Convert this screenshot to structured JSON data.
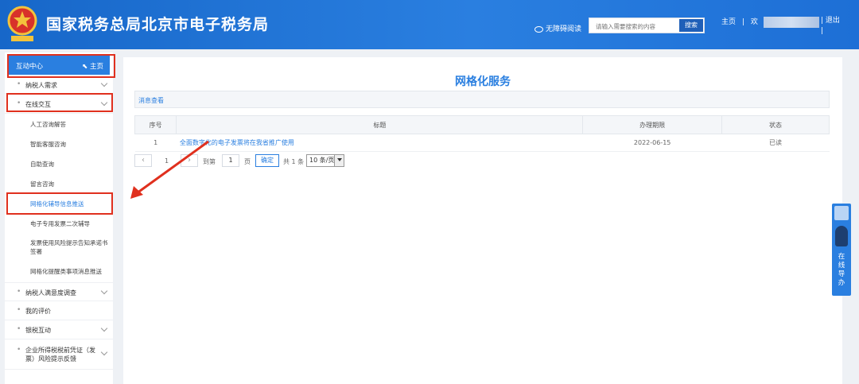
{
  "header": {
    "title": "国家税务总局北京市电子税务局",
    "accessible_label": "无障碍阅读",
    "search_placeholder": "请输入需要搜索的内容",
    "search_button": "搜索",
    "home_link": "主页",
    "welcome": "欢",
    "logout": "退出",
    "separator": "|"
  },
  "sidebar": {
    "head_title": "互动中心",
    "head_home": "主页",
    "items": [
      {
        "label": "纳税人需求"
      },
      {
        "label": "在线交互"
      },
      {
        "label": "纳税人满意度调查"
      },
      {
        "label": "我的评价"
      },
      {
        "label": "银税互动"
      },
      {
        "label": "企业所得税税前凭证（发票）风险提示反馈"
      }
    ],
    "subitems": [
      {
        "label": "人工咨询解答"
      },
      {
        "label": "智能客服咨询"
      },
      {
        "label": "自助查询"
      },
      {
        "label": "留言咨询"
      },
      {
        "label": "网格化辅导信息推送"
      },
      {
        "label": "电子专用发票二次辅导"
      },
      {
        "label": "发票使用风险提示告知承诺书签署"
      },
      {
        "label": "网格化提醒类事项消息推送"
      }
    ]
  },
  "main": {
    "title": "网格化服务",
    "tab_label": "消息查看",
    "columns": [
      "序号",
      "标题",
      "办理期限",
      "状态"
    ],
    "rows": [
      {
        "no": "1",
        "title": "全面数字化的电子发票将在我省推广使用",
        "deadline": "2022-06-15",
        "status": "已读"
      }
    ],
    "pager": {
      "prev": "‹",
      "page": "1",
      "next": "›",
      "goto_label": "到第",
      "goto_value": "1",
      "page_unit": "页",
      "confirm": "确定",
      "total": "共 1 条",
      "page_size": "10 条/页"
    }
  },
  "float_panel": {
    "text": "在线导办"
  },
  "colors": {
    "brand_blue": "#2a7fe0",
    "highlight_red": "#e0301e"
  }
}
